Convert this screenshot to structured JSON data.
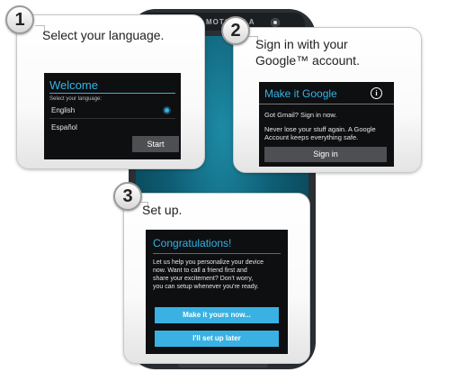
{
  "phone": {
    "brand": "MOTOROLA"
  },
  "steps": [
    {
      "number": "1",
      "text": "Select your language.",
      "dialog": {
        "title": "Welcome",
        "prompt": "Select your language:",
        "options": [
          "English",
          "Español"
        ],
        "selected": "English",
        "button": "Start"
      }
    },
    {
      "number": "2",
      "text_line1": "Sign in with your",
      "text_line2": "Google™ account.",
      "dialog": {
        "title": "Make it Google",
        "icon": "info-icon",
        "line1": "Got Gmail? Sign in now.",
        "line2": "Never lose your stuff again. A Google",
        "line3": "Account keeps everything safe.",
        "button": "Sign in"
      }
    },
    {
      "number": "3",
      "text": "Set up.",
      "dialog": {
        "title": "Congratulations!",
        "body": [
          "Let us help you personalize your device",
          "now. Want to call a friend first and",
          "share your excitement? Don't worry,",
          "you can setup whenever you're ready."
        ],
        "button_primary": "Make it yours now...",
        "button_secondary": "I'll set up later"
      }
    }
  ],
  "colors": {
    "accent": "#35b3e6",
    "dialog_bg": "#0e0f11",
    "button_gray": "#4d4f52"
  }
}
